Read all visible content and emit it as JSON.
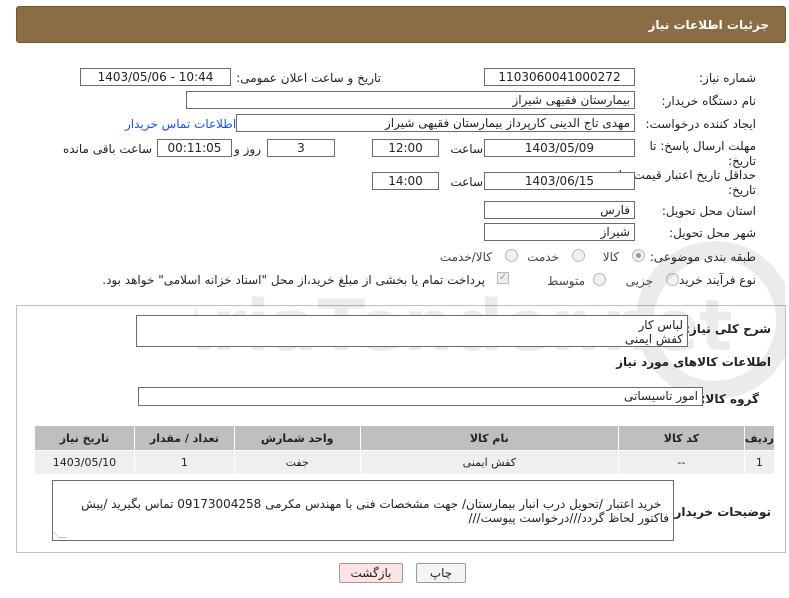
{
  "header": {
    "title": "جزئیات اطلاعات نیاز"
  },
  "fields": {
    "need_number": {
      "label": "شماره نیاز:",
      "value": "1103060041000272"
    },
    "announce_datetime": {
      "label": "تاریخ و ساعت اعلان عمومی:",
      "value": "1403/05/06 - 10:44"
    },
    "buyer_org": {
      "label": "نام دستگاه خریدار:",
      "value": "بیمارستان فقیهی شیراز"
    },
    "requester": {
      "label": "ایجاد کننده درخواست:",
      "value": "مهدی تاج الدینی کارپرداز بیمارستان فقیهی شیراز",
      "contact_link": "اطلاعات تماس خریدار"
    },
    "reply_deadline": {
      "label_line1": "مهلت ارسال پاسخ: تا",
      "label_line2": "تاریخ:",
      "date": "1403/05/09",
      "time_label": "ساعت",
      "time": "12:00",
      "days": "3",
      "days_label": "روز و",
      "remaining": "00:11:05",
      "remaining_label": "ساعت باقی مانده"
    },
    "price_validity": {
      "label_line1": "حداقل تاریخ اعتبار قیمت: تا",
      "label_line2": "تاریخ:",
      "date": "1403/06/15",
      "time_label": "ساعت",
      "time": "14:00"
    },
    "delivery_province": {
      "label": "استان محل تحویل:",
      "value": "فارس"
    },
    "delivery_city": {
      "label": "شهر محل تحویل:",
      "value": "شیراز"
    },
    "category": {
      "label": "طبقه بندی موضوعی:",
      "options": [
        "کالا",
        "خدمت",
        "کالا/خدمت"
      ],
      "selected": "کالا"
    },
    "purchase_process": {
      "label": "نوع فرآیند خرید :",
      "options": [
        "جزیی",
        "متوسط"
      ],
      "payment_note": "پرداخت تمام یا بخشی از مبلغ خرید،از محل \"اسناد خزانه اسلامی\" خواهد بود."
    }
  },
  "details": {
    "description_label": "شرح کلی نیاز:",
    "description": "لباس کار\nکفش ایمنی",
    "goods_info_title": "اطلاعات کالاهای مورد نیاز",
    "goods_group_label": "گروه کالا:",
    "goods_group": "امور تاسیساتی",
    "table": {
      "headers": [
        "ردیف",
        "کد کالا",
        "نام کالا",
        "واحد شمارش",
        "تعداد / مقدار",
        "تاریخ نیاز"
      ],
      "rows": [
        [
          "1",
          "--",
          "کفش ایمنی",
          "جفت",
          "1",
          "1403/05/10"
        ]
      ]
    },
    "buyer_notes_label": "توضیحات خریدار:",
    "buyer_notes": "خرید اعتبار /تحویل درب انبار بیمارستان/ جهت مشخصات فنی با مهندس مکرمی 09173004258 تماس بگیرید /پیش فاکتور لحاظ گردد///درخواست پیوست///"
  },
  "buttons": {
    "print": "چاپ",
    "back": "بازگشت"
  },
  "watermark": {
    "text": "AriaTender.net"
  },
  "colors": {
    "header_bg": "#8a6d45",
    "table_header_bg": "#bfbfbf",
    "link": "#2255cc",
    "back_button_bg": "#fde3e3"
  }
}
